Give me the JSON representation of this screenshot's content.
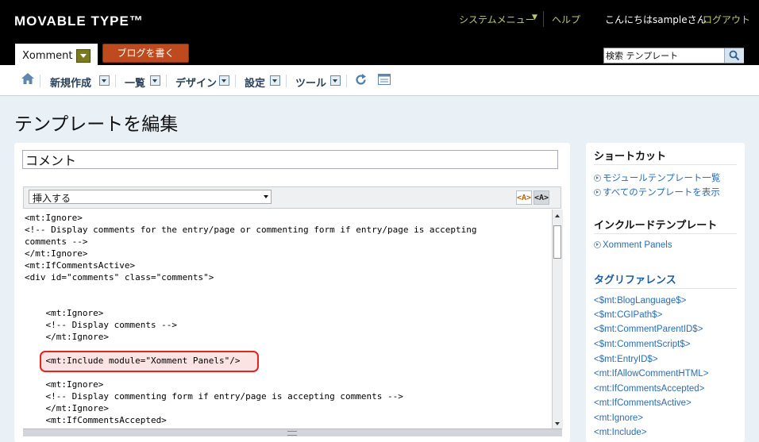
{
  "header": {
    "logo": "MOVABLE TYPE™",
    "system_menu": "システムメニュー",
    "help": "ヘルプ",
    "greeting": "こんにちはsampleさん",
    "logout": "ログアウト",
    "blog_name": "Xomment",
    "write_blog": "ブログを書く",
    "search_value": "検索 テンプレート"
  },
  "nav": {
    "items": [
      "新規作成",
      "一覧",
      "デザイン",
      "設定",
      "ツール"
    ]
  },
  "page_title": "テンプレートを編集",
  "editor": {
    "template_name": "コメント",
    "insert_label": "挿入する",
    "highlight_on": "<A>",
    "highlight_off": "<A>",
    "code_lines": [
      "<mt:Ignore>",
      "<!-- Display comments for the entry/page or commenting form if entry/page is accepting",
      "comments -->",
      "</mt:Ignore>",
      "<mt:IfCommentsActive>",
      "<div id=\"comments\" class=\"comments\">",
      "",
      "",
      "    <mt:Ignore>",
      "    <!-- Display comments -->",
      "    </mt:Ignore>",
      "",
      "    <mt:Include module=\"Xomment Panels\"/>",
      "",
      "    <mt:Ignore>",
      "    <!-- Display commenting form if entry/page is accepting comments -->",
      "    </mt:Ignore>",
      "    <mt:IfCommentsAccepted>"
    ]
  },
  "sidebar": {
    "shortcuts_title": "ショートカット",
    "shortcuts": [
      "モジュールテンプレート一覧",
      "すべてのテンプレートを表示"
    ],
    "includes_title": "インクルードテンプレート",
    "includes": [
      "Xomment Panels"
    ],
    "tags_title": "タグリファレンス",
    "tags": [
      "<$mt:BlogLanguage$>",
      "<$mt:CGIPath$>",
      "<$mt:CommentParentID$>",
      "<$mt:CommentScript$>",
      "<$mt:EntryID$>",
      "<mt:IfAllowCommentHTML>",
      "<mt:IfCommentsAccepted>",
      "<mt:IfCommentsActive>",
      "<mt:Ignore>",
      "<mt:Include>"
    ]
  }
}
